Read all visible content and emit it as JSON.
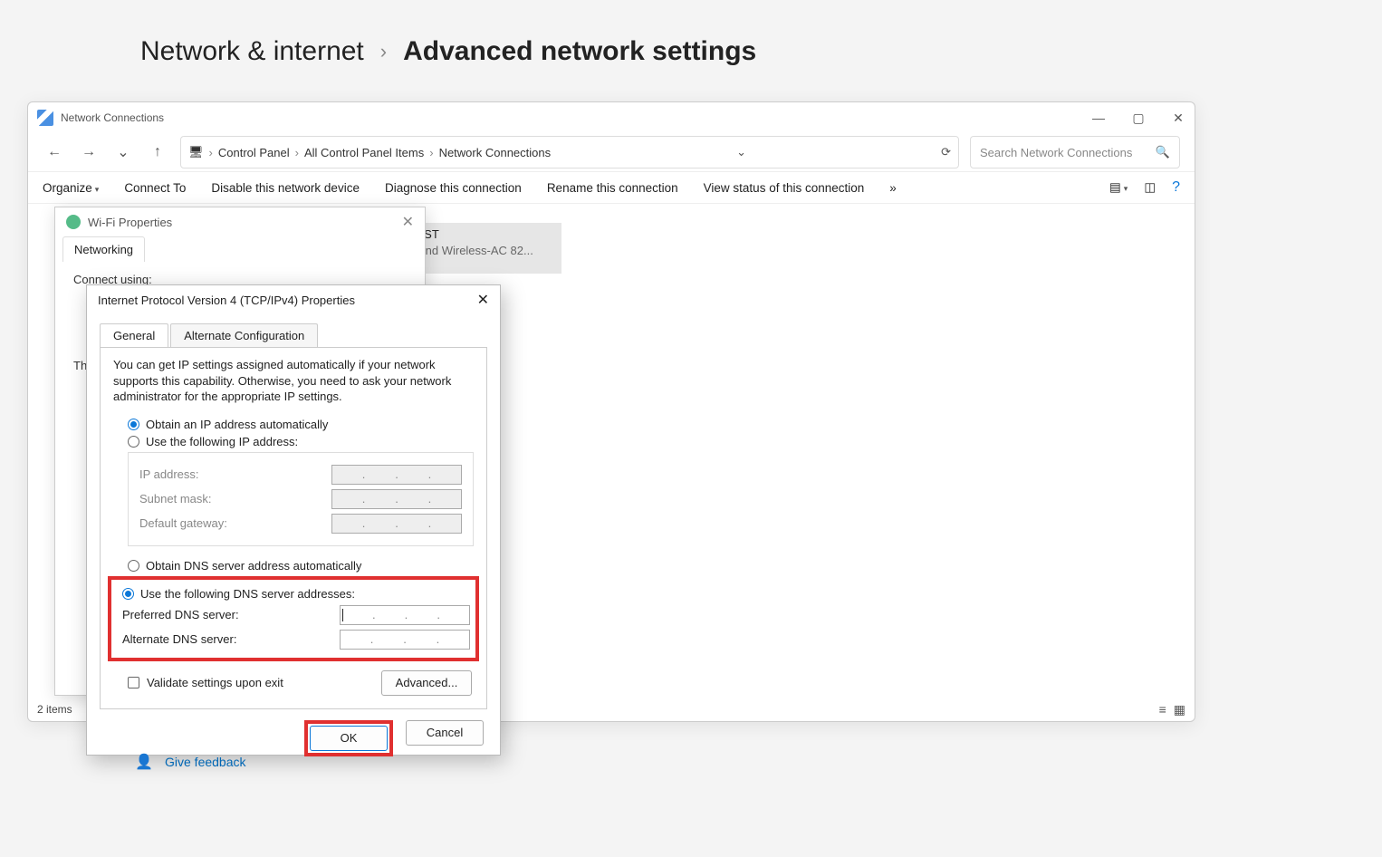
{
  "settings_breadcrumb": {
    "parent": "Network & internet",
    "current": "Advanced network settings"
  },
  "nc_window": {
    "title": "Network Connections",
    "address": {
      "parts": [
        "Control Panel",
        "All Control Panel Items",
        "Network Connections"
      ]
    },
    "search_placeholder": "Search Network Connections",
    "toolbar": {
      "organize": "Organize",
      "connect_to": "Connect To",
      "disable": "Disable this network device",
      "diagnose": "Diagnose this connection",
      "rename": "Rename this connection",
      "view_status": "View status of this connection"
    },
    "connection": {
      "ssid": "GUEST",
      "adapter": "al Band Wireless-AC 82..."
    },
    "status": "2 items"
  },
  "wifi_dialog": {
    "title": "Wi-Fi Properties",
    "tab": "Networking",
    "connect_using_label": "Connect using:",
    "this_label": "Th"
  },
  "ipv4_dialog": {
    "title": "Internet Protocol Version 4 (TCP/IPv4) Properties",
    "tabs": {
      "general": "General",
      "alternate": "Alternate Configuration"
    },
    "description": "You can get IP settings assigned automatically if your network supports this capability. Otherwise, you need to ask your network administrator for the appropriate IP settings.",
    "ip": {
      "auto": "Obtain an IP address automatically",
      "manual": "Use the following IP address:",
      "ip_label": "IP address:",
      "subnet_label": "Subnet mask:",
      "gateway_label": "Default gateway:"
    },
    "dns": {
      "auto": "Obtain DNS server address automatically",
      "manual": "Use the following DNS server addresses:",
      "preferred_label": "Preferred DNS server:",
      "alternate_label": "Alternate DNS server:"
    },
    "validate": "Validate settings upon exit",
    "advanced": "Advanced...",
    "ok": "OK",
    "cancel": "Cancel"
  },
  "feedback": "Give feedback"
}
